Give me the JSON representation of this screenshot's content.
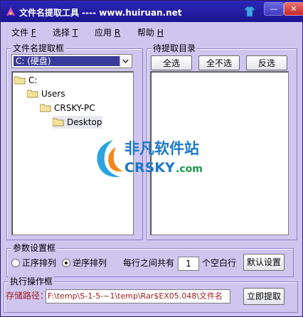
{
  "window": {
    "title": "文件名提取工具 ---- www.huiruan.net"
  },
  "titlebar": {
    "minimize": "—",
    "close": "✕"
  },
  "menu": [
    {
      "label": "文件",
      "accel": "F"
    },
    {
      "label": "选择",
      "accel": "T"
    },
    {
      "label": "应用",
      "accel": "R"
    },
    {
      "label": "帮助",
      "accel": "H"
    }
  ],
  "left_group": {
    "title": "文件名提取框",
    "drive": "C: (硬盘)",
    "tree": [
      "C:",
      "Users",
      "CRSKY-PC",
      "Desktop"
    ]
  },
  "right_group": {
    "title": "待提取目录",
    "select_all": "全选",
    "select_none": "全不选",
    "invert": "反选"
  },
  "params": {
    "title": "参数设置框",
    "asc": "正序排列",
    "desc": "逆序排列",
    "blank_prefix": "每行之间共有",
    "blank_count": "1",
    "blank_suffix": "个空白行",
    "default_btn": "默认设置"
  },
  "exec": {
    "title": "执行操作框",
    "path_label": "存储路径：",
    "path_value": "F:\\temp\\S-1-5-~1\\temp\\Rar$EX05.048\\文件名",
    "extract_btn": "立即提取"
  },
  "watermark": {
    "cn": "非凡软件站",
    "en_a": "CRSKY",
    "en_b": ".com"
  },
  "colors": {
    "titlebar": "#2c26b8",
    "window_bg": "#cfc6f0",
    "path_text": "#a02020"
  }
}
